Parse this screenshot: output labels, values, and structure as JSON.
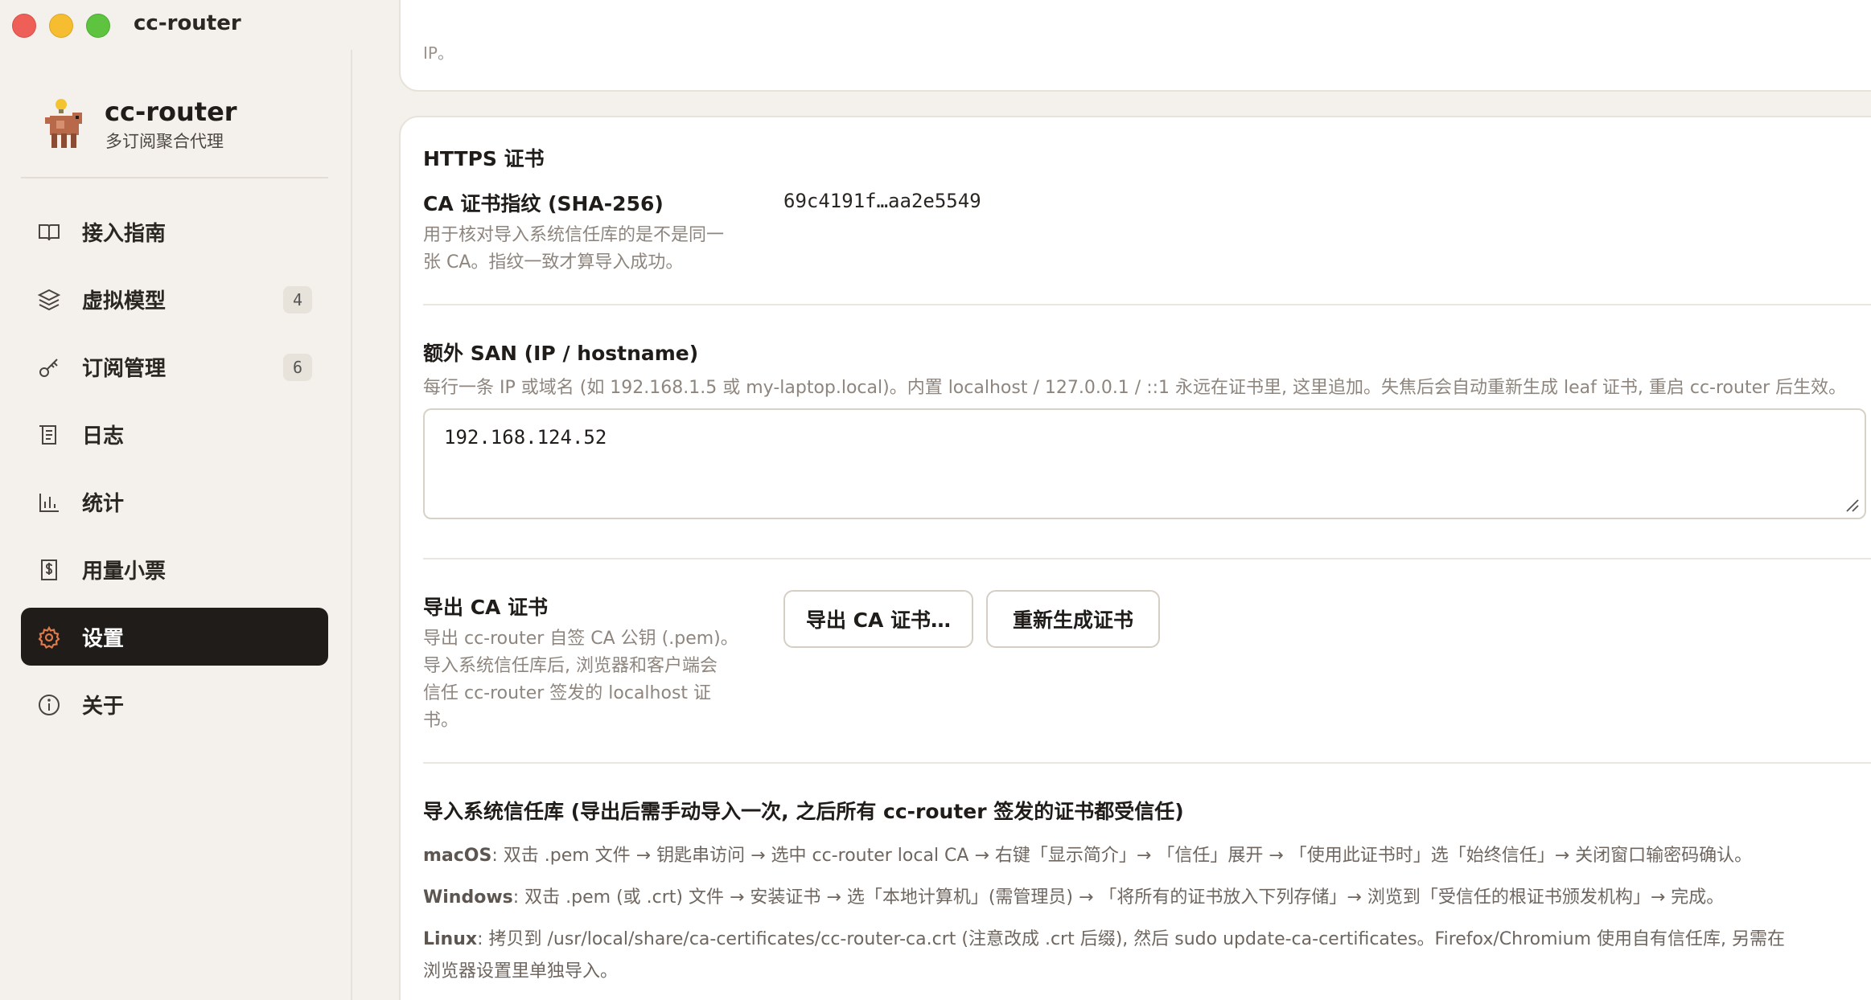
{
  "window": {
    "title": "cc-router"
  },
  "brand": {
    "name": "cc-router",
    "subtitle": "多订阅聚合代理"
  },
  "sidebar": {
    "items": [
      {
        "label": "接入指南",
        "icon": "book-icon",
        "badge": null,
        "active": false
      },
      {
        "label": "虚拟模型",
        "icon": "layers-icon",
        "badge": "4",
        "active": false
      },
      {
        "label": "订阅管理",
        "icon": "key-icon",
        "badge": "6",
        "active": false
      },
      {
        "label": "日志",
        "icon": "scroll-icon",
        "badge": null,
        "active": false
      },
      {
        "label": "统计",
        "icon": "bar-chart-icon",
        "badge": null,
        "active": false
      },
      {
        "label": "用量小票",
        "icon": "receipt-icon",
        "badge": null,
        "active": false
      },
      {
        "label": "设置",
        "icon": "gear-icon",
        "badge": null,
        "active": true
      },
      {
        "label": "关于",
        "icon": "info-icon",
        "badge": null,
        "active": false
      }
    ]
  },
  "prev_card": {
    "trailing_text": "IP。"
  },
  "https": {
    "title": "HTTPS 证书",
    "fingerprint": {
      "label": "CA 证书指纹 (SHA-256)",
      "help_line1": "用于核对导入系统信任库的是不是同一",
      "help_line2": "张 CA。指纹一致才算导入成功。",
      "value": "69c4191f…aa2e5549"
    },
    "san": {
      "label": "额外 SAN (IP / hostname)",
      "help": "每行一条 IP 或域名 (如 192.168.1.5 或 my-laptop.local)。内置 localhost / 127.0.0.1 / ::1 永远在证书里, 这里追加。失焦后会自动重新生成 leaf 证书, 重启 cc-router 后生效。",
      "value": "192.168.124.52"
    },
    "export": {
      "label": "导出 CA 证书",
      "help_line1": "导出 cc-router 自签 CA 公钥 (.pem)。",
      "help_line2": "导入系统信任库后, 浏览器和客户端会",
      "help_line3": "信任 cc-router 签发的 localhost 证",
      "help_line4": "书。",
      "export_button": "导出 CA 证书…",
      "regen_button": "重新生成证书"
    },
    "trust": {
      "title": "导入系统信任库 (导出后需手动导入一次, 之后所有 cc-router 签发的证书都受信任)",
      "macos_os": "macOS",
      "macos_text": ": 双击 .pem 文件 → 钥匙串访问 → 选中 cc-router local CA → 右键「显示简介」→ 「信任」展开 → 「使用此证书时」选「始终信任」→ 关闭窗口输密码确认。",
      "windows_os": "Windows",
      "windows_text": ": 双击 .pem (或 .crt) 文件 → 安装证书 → 选「本地计算机」(需管理员) → 「将所有的证书放入下列存储」→ 浏览到「受信任的根证书颁发机构」→ 完成。",
      "linux_os": "Linux",
      "linux_text1": ": 拷贝到 /usr/local/share/ca-certificates/cc-router-ca.crt (注意改成 .crt 后缀), 然后 sudo update-ca-certificates。Firefox/Chromium 使用自有信任库, 另需在",
      "linux_text2": "浏览器设置里单独导入。"
    }
  },
  "colors": {
    "accent": "#e07a4a",
    "active_bg": "#1f1c19"
  }
}
